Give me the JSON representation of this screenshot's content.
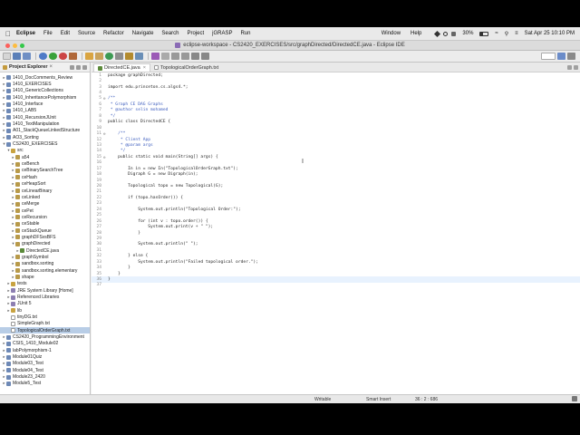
{
  "menubar": {
    "app": "Eclipse",
    "items": [
      "File",
      "Edit",
      "Source",
      "Refactor",
      "Navigate",
      "Search",
      "Project",
      "jGRASP",
      "Run"
    ],
    "window": "Window",
    "help": "Help",
    "battery": "30%",
    "datetime": "Sat Apr 25  10:10 PM"
  },
  "window": {
    "title": "eclipse-workspace - CS2420_EXERCISES/src/graphDirected/DirectedCE.java - Eclipse IDE"
  },
  "explorer": {
    "title": "Project Explorer",
    "items": [
      {
        "label": "1410_DocComments_Review",
        "indent": 0,
        "arrow": "▸",
        "kind": "project"
      },
      {
        "label": "1410_EXERCISES",
        "indent": 0,
        "arrow": "▸",
        "kind": "project"
      },
      {
        "label": "1410_GenericCollections",
        "indent": 0,
        "arrow": "▸",
        "kind": "project"
      },
      {
        "label": "1410_InheritancePolymorphism",
        "indent": 0,
        "arrow": "▸",
        "kind": "project"
      },
      {
        "label": "1410_Interface",
        "indent": 0,
        "arrow": "▸",
        "kind": "project"
      },
      {
        "label": "1410_LAB5",
        "indent": 0,
        "arrow": "▸",
        "kind": "project"
      },
      {
        "label": "1410_RecursionJUnit",
        "indent": 0,
        "arrow": "▸",
        "kind": "project"
      },
      {
        "label": "1410_TextManipulation",
        "indent": 0,
        "arrow": "▸",
        "kind": "project"
      },
      {
        "label": "A01_StackQueueLinkedStructure",
        "indent": 0,
        "arrow": "▸",
        "kind": "project"
      },
      {
        "label": "AO3_Sorting",
        "indent": 0,
        "arrow": "▸",
        "kind": "project"
      },
      {
        "label": "CS2420_EXERCISES",
        "indent": 0,
        "arrow": "▾",
        "kind": "project"
      },
      {
        "label": "src",
        "indent": 1,
        "arrow": "▾",
        "kind": "folder"
      },
      {
        "label": "a54",
        "indent": 2,
        "arrow": "▸",
        "kind": "package"
      },
      {
        "label": "ceBench",
        "indent": 2,
        "arrow": "▸",
        "kind": "package"
      },
      {
        "label": "ceBinarySearchTree",
        "indent": 2,
        "arrow": "▸",
        "kind": "package"
      },
      {
        "label": "ceHash",
        "indent": 2,
        "arrow": "▸",
        "kind": "package"
      },
      {
        "label": "ceHeapSort",
        "indent": 2,
        "arrow": "▸",
        "kind": "package"
      },
      {
        "label": "ceLinearBinary",
        "indent": 2,
        "arrow": "▸",
        "kind": "package"
      },
      {
        "label": "ceLinked",
        "indent": 2,
        "arrow": "▸",
        "kind": "package"
      },
      {
        "label": "ceMerge",
        "indent": 2,
        "arrow": "▸",
        "kind": "package"
      },
      {
        "label": "cePet",
        "indent": 2,
        "arrow": "▸",
        "kind": "package"
      },
      {
        "label": "ceRecursion",
        "indent": 2,
        "arrow": "▸",
        "kind": "package"
      },
      {
        "label": "ceStable",
        "indent": 2,
        "arrow": "▸",
        "kind": "package"
      },
      {
        "label": "ceStackQueue",
        "indent": 2,
        "arrow": "▸",
        "kind": "package"
      },
      {
        "label": "graphDFSvsBFS",
        "indent": 2,
        "arrow": "▸",
        "kind": "package"
      },
      {
        "label": "graphDirected",
        "indent": 2,
        "arrow": "▾",
        "kind": "package"
      },
      {
        "label": "DirectedCE.java",
        "indent": 3,
        "arrow": "▸",
        "kind": "java"
      },
      {
        "label": "graphSymbol",
        "indent": 2,
        "arrow": "▸",
        "kind": "package"
      },
      {
        "label": "sandbox.sorting",
        "indent": 2,
        "arrow": "▸",
        "kind": "package"
      },
      {
        "label": "sandbox.sorting.elementary",
        "indent": 2,
        "arrow": "▸",
        "kind": "package"
      },
      {
        "label": "shape",
        "indent": 2,
        "arrow": "▸",
        "kind": "package"
      },
      {
        "label": "tests",
        "indent": 1,
        "arrow": "▸",
        "kind": "folder"
      },
      {
        "label": "JRE System Library [Home]",
        "indent": 1,
        "arrow": "▸",
        "kind": "library"
      },
      {
        "label": "Referenced Libraries",
        "indent": 1,
        "arrow": "▸",
        "kind": "library"
      },
      {
        "label": "JUnit 5",
        "indent": 1,
        "arrow": "▸",
        "kind": "library"
      },
      {
        "label": "lib",
        "indent": 1,
        "arrow": "▸",
        "kind": "folder"
      },
      {
        "label": "tinyDG.txt",
        "indent": 1,
        "arrow": "",
        "kind": "text"
      },
      {
        "label": "SimpleGraph.txt",
        "indent": 1,
        "arrow": "",
        "kind": "text"
      },
      {
        "label": "TopologicalOrderGraph.txt",
        "indent": 1,
        "arrow": "",
        "kind": "text",
        "selected": true
      },
      {
        "label": "CS2420_ProgrammingEnvironment",
        "indent": 0,
        "arrow": "▸",
        "kind": "project"
      },
      {
        "label": "CSIS_1410_Module02",
        "indent": 0,
        "arrow": "▸",
        "kind": "project"
      },
      {
        "label": "labPolymorphism-1",
        "indent": 0,
        "arrow": "▸",
        "kind": "project"
      },
      {
        "label": "Module01Quiz",
        "indent": 0,
        "arrow": "▸",
        "kind": "project"
      },
      {
        "label": "Module03_Test",
        "indent": 0,
        "arrow": "▸",
        "kind": "project"
      },
      {
        "label": "Module04_Test",
        "indent": 0,
        "arrow": "▸",
        "kind": "project"
      },
      {
        "label": "Module23_2420",
        "indent": 0,
        "arrow": "▸",
        "kind": "project"
      },
      {
        "label": "Module5_Test",
        "indent": 0,
        "arrow": "▸",
        "kind": "project"
      }
    ]
  },
  "editor": {
    "tabs": [
      {
        "label": "DirectedCE.java",
        "active": true,
        "kind": "java"
      },
      {
        "label": "TopologicalOrderGraph.txt",
        "active": false,
        "kind": "text"
      }
    ],
    "lines": [
      {
        "n": "1",
        "m": "",
        "t": "package graphDirected;"
      },
      {
        "n": "2",
        "m": "",
        "t": ""
      },
      {
        "n": "3",
        "m": "",
        "t": "import edu.princeton.cs.algs4.*;"
      },
      {
        "n": "4",
        "m": "",
        "t": ""
      },
      {
        "n": "5",
        "m": "⊖",
        "t": "/**"
      },
      {
        "n": "6",
        "m": "",
        "t": " * Graph CE DAG Graphs"
      },
      {
        "n": "7",
        "m": "",
        "t": " * @author selin mohamed"
      },
      {
        "n": "8",
        "m": "",
        "t": " */"
      },
      {
        "n": "9",
        "m": "",
        "t": "public class DirectedCE {"
      },
      {
        "n": "10",
        "m": "",
        "t": ""
      },
      {
        "n": "11",
        "m": "⊖",
        "t": "    /**"
      },
      {
        "n": "12",
        "m": "",
        "t": "     * Client App"
      },
      {
        "n": "13",
        "m": "",
        "t": "     * @param args"
      },
      {
        "n": "14",
        "m": "",
        "t": "     */"
      },
      {
        "n": "15",
        "m": "⊖",
        "t": "    public static void main(String[] args) {"
      },
      {
        "n": "16",
        "m": "",
        "t": ""
      },
      {
        "n": "17",
        "m": "",
        "t": "        In in = new In(\"TopologicalOrderGraph.txt\");"
      },
      {
        "n": "18",
        "m": "",
        "t": "        Digraph G = new Digraph(in);"
      },
      {
        "n": "19",
        "m": "",
        "t": ""
      },
      {
        "n": "20",
        "m": "",
        "t": "        Topological topo = new Topological(G);"
      },
      {
        "n": "21",
        "m": "",
        "t": ""
      },
      {
        "n": "22",
        "m": "",
        "t": "        if (topo.hasOrder()) {"
      },
      {
        "n": "23",
        "m": "",
        "t": ""
      },
      {
        "n": "24",
        "m": "",
        "t": "            System.out.println(\"Topological Order:\");"
      },
      {
        "n": "25",
        "m": "",
        "t": ""
      },
      {
        "n": "26",
        "m": "",
        "t": "            for (int v : topo.order()) {"
      },
      {
        "n": "27",
        "m": "",
        "t": "                System.out.print(v + \" \");"
      },
      {
        "n": "28",
        "m": "",
        "t": "            }"
      },
      {
        "n": "29",
        "m": "",
        "t": ""
      },
      {
        "n": "30",
        "m": "",
        "t": "            System.out.println(\" \");"
      },
      {
        "n": "31",
        "m": "",
        "t": ""
      },
      {
        "n": "32",
        "m": "",
        "t": "        } else {"
      },
      {
        "n": "33",
        "m": "",
        "t": "            System.out.println(\"Failed topological order.\");"
      },
      {
        "n": "34",
        "m": "",
        "t": "        }"
      },
      {
        "n": "35",
        "m": "",
        "t": "    }"
      },
      {
        "n": "36",
        "m": "",
        "t": "}"
      },
      {
        "n": "37",
        "m": "",
        "t": ""
      }
    ]
  },
  "status": {
    "writable": "Writable",
    "insert_mode": "Smart Insert",
    "position": "36 : 2 : 686"
  },
  "colors": {
    "keyword": "#7f0055",
    "comment": "#3f7f5f",
    "javadoc": "#3f5fbf",
    "string": "#2a00ff",
    "selection": "#b8cde6"
  }
}
